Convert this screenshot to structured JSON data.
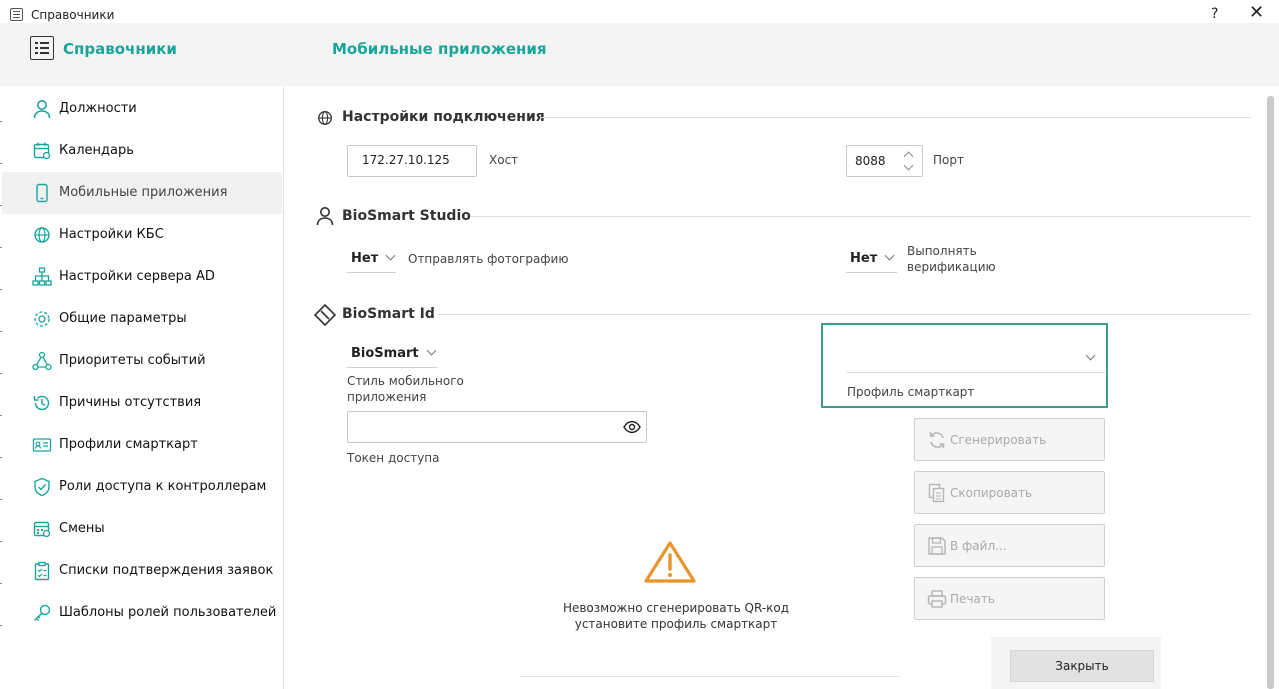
{
  "window": {
    "title": "Справочники",
    "help_label": "?",
    "close_label": "✕"
  },
  "header": {
    "app_title": "Справочники",
    "page_title": "Мобильные приложения"
  },
  "sidebar": {
    "items": [
      {
        "label": "Должности",
        "icon": "user-icon"
      },
      {
        "label": "Календарь",
        "icon": "calendar-icon"
      },
      {
        "label": "Мобильные приложения",
        "icon": "phone-icon",
        "active": true
      },
      {
        "label": "Настройки КБС",
        "icon": "globe-icon"
      },
      {
        "label": "Настройки сервера AD",
        "icon": "hierarchy-icon"
      },
      {
        "label": "Общие параметры",
        "icon": "gear-icon"
      },
      {
        "label": "Приоритеты событий",
        "icon": "nodes-icon"
      },
      {
        "label": "Причины отсутствия",
        "icon": "history-icon"
      },
      {
        "label": "Профили смарткарт",
        "icon": "id-card-icon"
      },
      {
        "label": "Роли доступа к контроллерам",
        "icon": "shield-icon"
      },
      {
        "label": "Смены",
        "icon": "shift-calendar-icon"
      },
      {
        "label": "Списки подтверждения заявок",
        "icon": "clipboard-icon"
      },
      {
        "label": "Шаблоны ролей пользователей",
        "icon": "key-icon"
      }
    ]
  },
  "connection": {
    "title": "Настройки подключения",
    "host_value": "172.27.10.125",
    "host_label": "Хост",
    "port_value": "8088",
    "port_label": "Порт"
  },
  "studio": {
    "title": "BioSmart Studio",
    "send_photo_value": "Нет",
    "send_photo_label": "Отправлять фотографию",
    "verify_value": "Нет",
    "verify_label_line1": "Выполнять",
    "verify_label_line2": "верификацию"
  },
  "biosmart_id": {
    "title": "BioSmart Id",
    "style_value": "BioSmart",
    "style_label_line1": "Стиль мобильного",
    "style_label_line2": "приложения",
    "token_value": "",
    "token_label": "Токен доступа",
    "profile_value": "",
    "profile_label": "Профиль смарткарт"
  },
  "actions": {
    "generate": "Сгенерировать",
    "copy": "Скопировать",
    "to_file": "В файл...",
    "print": "Печать"
  },
  "warning": {
    "line1": "Невозможно сгенерировать QR-код",
    "line2": "установите профиль смарткарт"
  },
  "footer": {
    "close_label": "Закрыть"
  },
  "colors": {
    "accent": "#1aa59b",
    "warning": "#e8952a",
    "focus_border": "#3e9a8f"
  }
}
